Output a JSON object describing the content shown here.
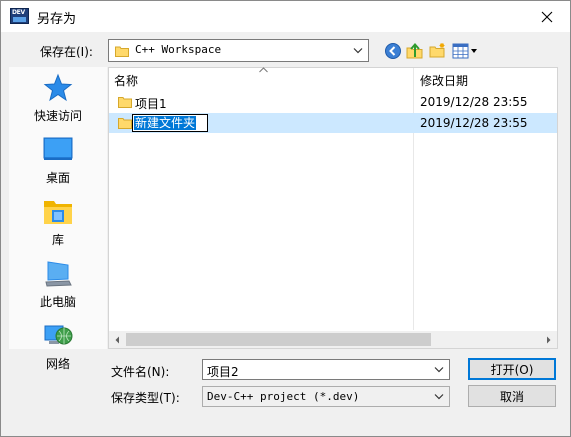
{
  "window": {
    "title": "另存为",
    "app_icon_text": "DEV"
  },
  "save_in": {
    "label": "保存在(I):",
    "value": "C++ Workspace"
  },
  "toolbar": {
    "back_icon": "back-arrow-icon",
    "up_icon": "up-folder-icon",
    "new_folder_icon": "new-folder-icon",
    "view_icon": "view-menu-icon"
  },
  "places": [
    {
      "label": "快速访问",
      "icon": "star-icon"
    },
    {
      "label": "桌面",
      "icon": "desktop-icon"
    },
    {
      "label": "库",
      "icon": "library-icon"
    },
    {
      "label": "此电脑",
      "icon": "computer-icon"
    },
    {
      "label": "网络",
      "icon": "network-icon"
    }
  ],
  "list": {
    "columns": {
      "name": "名称",
      "modified": "修改日期"
    },
    "rows": [
      {
        "name": "项目1",
        "date": "2019/12/28 23:55"
      },
      {
        "name": "新建文件夹",
        "date": "2019/12/28 23:55"
      }
    ]
  },
  "filename": {
    "label": "文件名(N):",
    "value": "项目2"
  },
  "filetype": {
    "label": "保存类型(T):",
    "value": "Dev-C++ project (*.dev)"
  },
  "buttons": {
    "open": "打开(O)",
    "cancel": "取消"
  },
  "colors": {
    "selection": "#cce8ff",
    "accent": "#0078d7",
    "folder": "#ffd96b"
  }
}
